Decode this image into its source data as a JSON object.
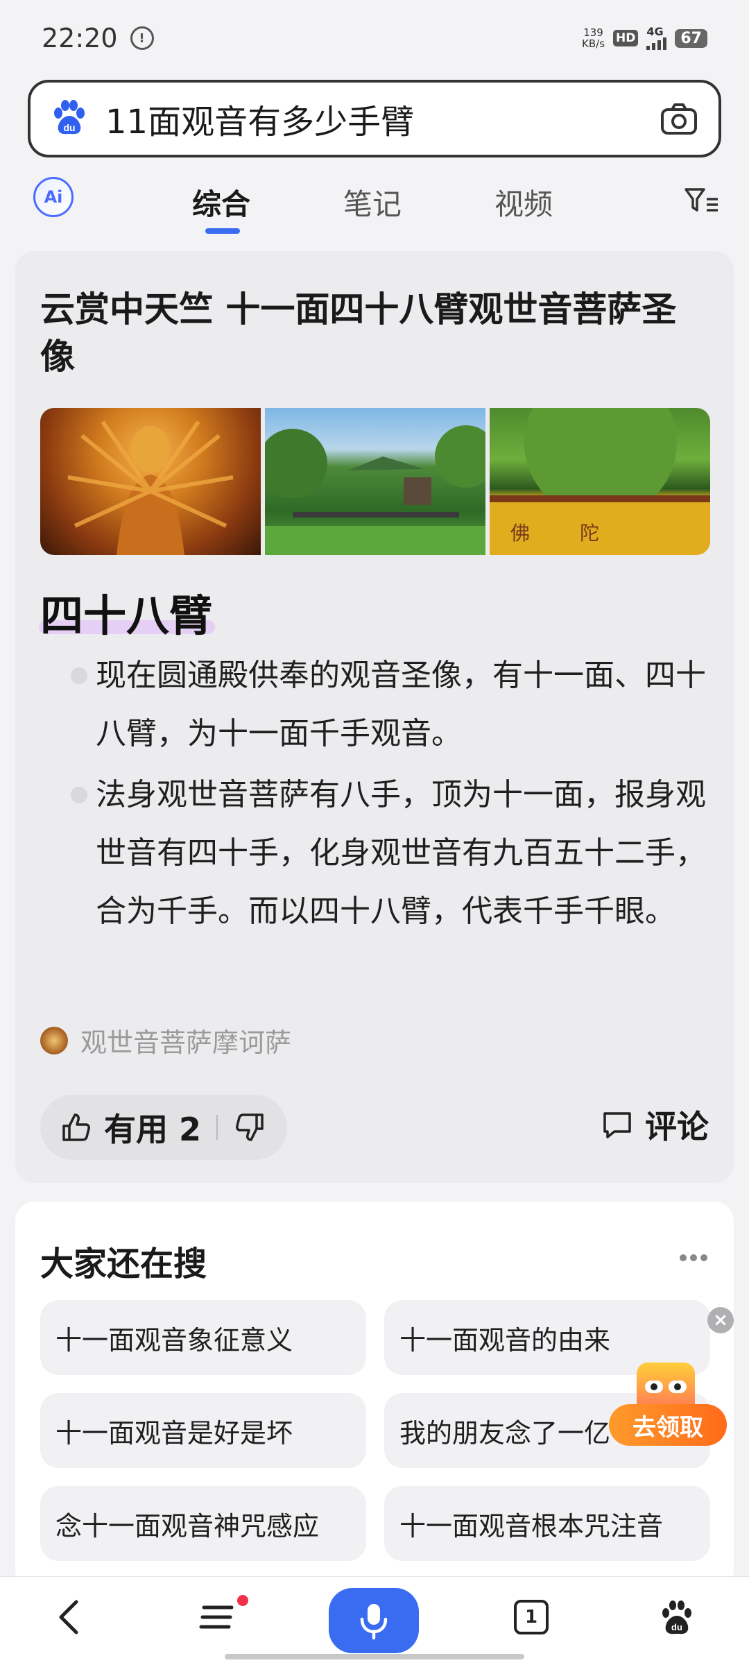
{
  "status_bar": {
    "time": "22:20",
    "net_speed_value": "139",
    "net_speed_unit": "KB/s",
    "hd_label": "HD",
    "signal_label": "4G",
    "battery": "67"
  },
  "search": {
    "query": "11面观音有多少手臂"
  },
  "tabs": {
    "items": [
      {
        "label": "综合",
        "active": true
      },
      {
        "label": "笔记",
        "active": false
      },
      {
        "label": "视频",
        "active": false
      }
    ],
    "ai_label": "Ai"
  },
  "answer_card": {
    "title": "云赏中天竺 十一面四十八臂观世音菩萨圣像",
    "answer": "四十八臂",
    "bullets": [
      "现在圆通殿供奉的观音圣像，有十一面、四十八臂，为十一面千手观音。",
      "法身观世音菩萨有八手，顶为十一面，报身观世音有四十手，化身观世音有九百五十二手，合为千手。而以四十八臂，代表千手千眼。"
    ],
    "source": "观世音菩萨摩诃萨",
    "useful_label": "有用 2",
    "comment_label": "评论"
  },
  "related": {
    "title": "大家还在搜",
    "chips": [
      "十一面观音象征意义",
      "十一面观音的由来",
      "十一面观音是好是坏",
      "我的朋友念了一亿",
      "念十一面观音神咒感应",
      "十一面观音根本咒注音"
    ]
  },
  "floating": {
    "button_label": "去领取"
  },
  "bottom_nav": {
    "tab_count": "1"
  },
  "colors": {
    "accent": "#3a6cf2",
    "answer_highlight": "#e6cff4",
    "float_button": "#ff7a1e",
    "notification_dot": "#f2304a"
  }
}
